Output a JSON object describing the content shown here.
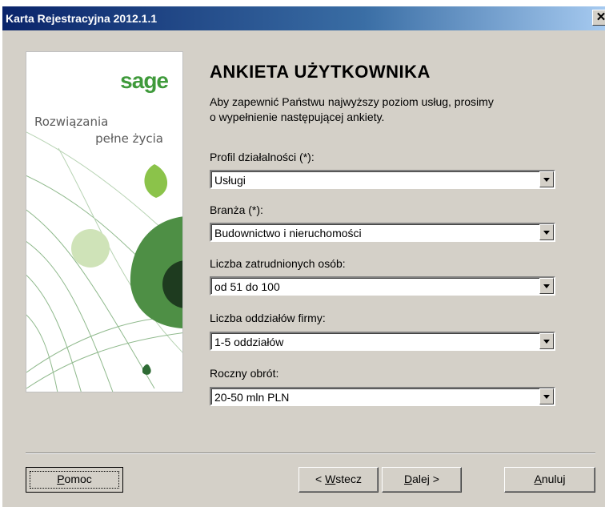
{
  "window": {
    "title": "Karta Rejestracyjna 2012.1.1",
    "close_glyph": "✕"
  },
  "side_panel": {
    "logo": "sage",
    "tagline_line1": "Rozwiązania",
    "tagline_line2": "pełne życia"
  },
  "main": {
    "heading": "ANKIETA UŻYTKOWNIKA",
    "intro_line1": "Aby zapewnić Państwu najwyższy poziom usług, prosimy",
    "intro_line2": "o wypełnienie następującej ankiety.",
    "fields": [
      {
        "label": "Profil działalności (*):",
        "value": "Usługi"
      },
      {
        "label": "Branża (*):",
        "value": "Budownictwo i nieruchomości"
      },
      {
        "label": "Liczba zatrudnionych osób:",
        "value": "od 51 do 100"
      },
      {
        "label": "Liczba oddziałów firmy:",
        "value": "1-5 oddziałów"
      },
      {
        "label": "Roczny obrót:",
        "value": "20-50 mln PLN"
      }
    ]
  },
  "buttons": {
    "help": {
      "pre": "",
      "key": "P",
      "post": "omoc"
    },
    "back": {
      "pre": "< ",
      "key": "W",
      "post": "stecz"
    },
    "next": {
      "pre": "",
      "key": "D",
      "post": "alej >"
    },
    "cancel": {
      "pre": "",
      "key": "A",
      "post": "nuluj"
    }
  },
  "colors": {
    "title_bar": "#0a246a",
    "dialog_bg": "#d4d0c8",
    "sage_green": "#3f9a3b"
  }
}
